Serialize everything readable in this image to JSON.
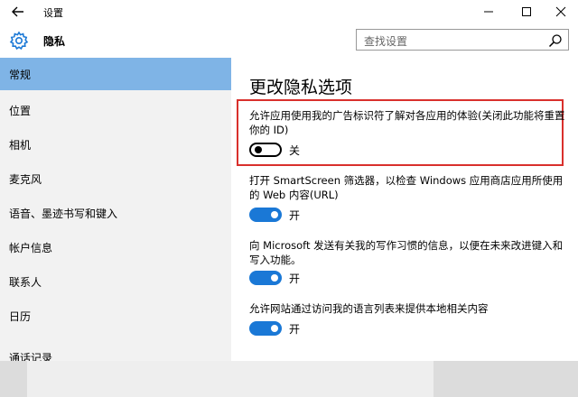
{
  "window": {
    "title": "设置"
  },
  "header": {
    "page_name": "隐私",
    "search_placeholder": "查找设置"
  },
  "sidebar": {
    "items": [
      {
        "label": "常规",
        "active": true
      },
      {
        "label": "位置"
      },
      {
        "label": "相机"
      },
      {
        "label": "麦克风"
      },
      {
        "label": "语音、墨迹书写和键入"
      },
      {
        "label": "帐户信息"
      },
      {
        "label": "联系人"
      },
      {
        "label": "日历"
      },
      {
        "label": "通话记录"
      }
    ]
  },
  "main": {
    "title": "更改隐私选项",
    "settings": [
      {
        "text": "允许应用使用我的广告标识符了解对各应用的体验(关闭此功能将重置你的 ID)",
        "state_label": "关",
        "on": false
      },
      {
        "text": "打开 SmartScreen 筛选器，以检查 Windows 应用商店应用所使用的 Web 内容(URL)",
        "state_label": "开",
        "on": true
      },
      {
        "text": "向 Microsoft 发送有关我的写作习惯的信息，以便在未来改进键入和写入功能。",
        "state_label": "开",
        "on": true
      },
      {
        "text": "允许网站通过访问我的语言列表来提供本地相关内容",
        "state_label": "开",
        "on": true
      }
    ]
  },
  "colors": {
    "accent": "#1a78d6",
    "active_nav": "#7fb4e6",
    "highlight_border": "#d9302c"
  },
  "icons": [
    "back-arrow-icon",
    "minimize-icon",
    "maximize-icon",
    "close-icon",
    "gear-icon",
    "search-icon"
  ]
}
